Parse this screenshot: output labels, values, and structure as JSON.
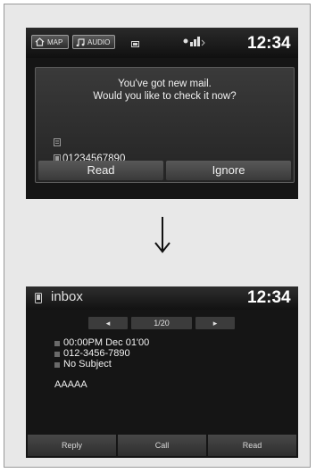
{
  "screen1": {
    "tabs": {
      "map": "MAP",
      "audio": "AUDIO"
    },
    "clock": "12:34",
    "dialog": {
      "line1": "You've got new mail.",
      "line2": "Would you like to check it now?",
      "number": "01234567890",
      "read_label": "Read",
      "ignore_label": "Ignore"
    }
  },
  "screen2": {
    "title": "inbox",
    "clock": "12:34",
    "pager": {
      "prev": "◂",
      "page": "1/20",
      "next": "▸"
    },
    "message": {
      "datetime": "00:00PM Dec 01'00",
      "phone": "012-3456-7890",
      "subject": "No Subject",
      "body": "AAAAA"
    },
    "softkeys": {
      "reply": "Reply",
      "call": "Call",
      "read": "Read"
    }
  },
  "arrow": "↓"
}
